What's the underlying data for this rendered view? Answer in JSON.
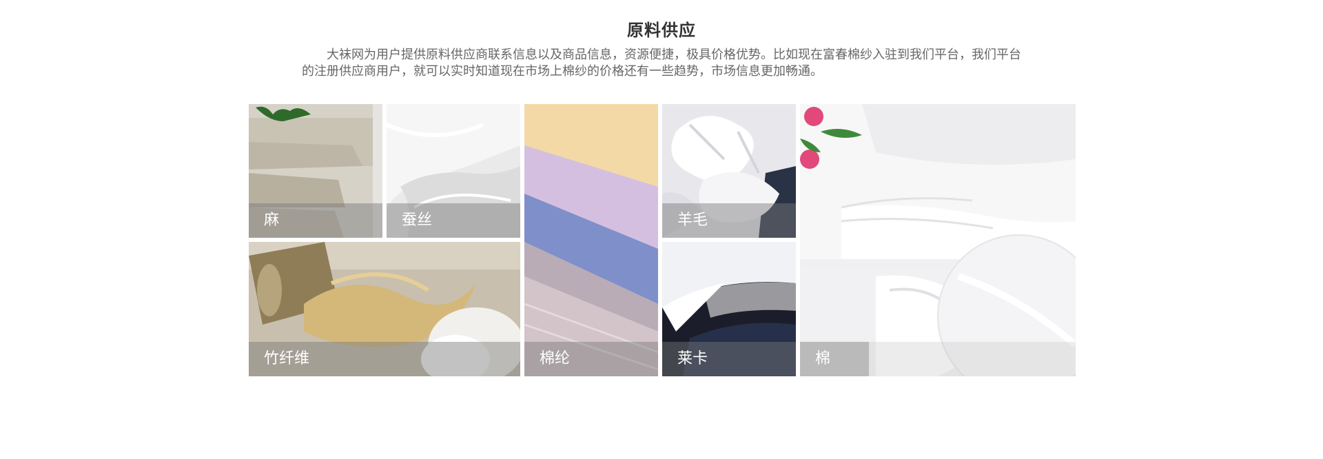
{
  "section": {
    "title": "原料供应",
    "intro": "大袜网为用户提供原料供应商联系信息以及商品信息，资源便捷，极具价格优势。比如现在富春棉纱入驻到我们平台，我们平台\n的注册供应商用户，就可以实时知道现在市场上棉纱的价格还有一些趋势，市场信息更加畅通。"
  },
  "materials": {
    "ma": {
      "label": "麻",
      "image": "folded-linen-fabric"
    },
    "cansi": {
      "label": "蚕丝",
      "image": "white-silk-fabric"
    },
    "zhuxianwei": {
      "label": "竹纤维",
      "image": "bamboo-fiber-bundle"
    },
    "mianlun": {
      "label": "棉纶",
      "image": "stacked-colored-fabrics"
    },
    "yangmao": {
      "label": "羊毛",
      "image": "white-wool-felt"
    },
    "laika": {
      "label": "莱卡",
      "image": "layered-lycra-fabric"
    },
    "mian": {
      "label": "棉",
      "image": "white-cotton-cloth-with-flowers"
    }
  },
  "colors": {
    "title": "#333333",
    "text": "#666666",
    "caption_bg": "rgba(120,120,120,0.45)",
    "caption_text": "#ffffff"
  }
}
